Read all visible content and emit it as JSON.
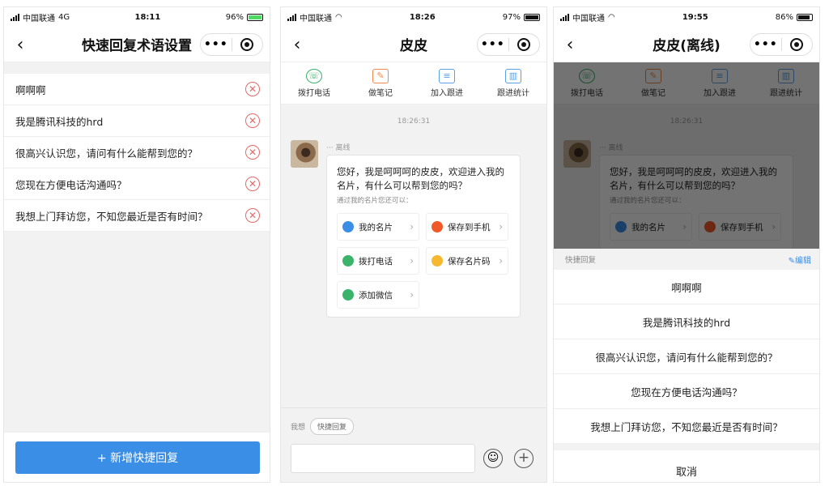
{
  "phone1": {
    "status": {
      "carrier": "中国联通",
      "network": "4G",
      "time": "18:11",
      "battery": "96%"
    },
    "title": "快速回复术语设置",
    "items": [
      {
        "text": "啊啊啊"
      },
      {
        "text": "我是腾讯科技的hrd"
      },
      {
        "text": "很高兴认识您，请问有什么能帮到您的？"
      },
      {
        "text": "您现在方便电话沟通吗？"
      },
      {
        "text": "我想上门拜访您，不知您最近是否有时间？"
      }
    ],
    "add_button": "+ 新增快捷回复"
  },
  "phone2": {
    "status": {
      "carrier": "中国联通",
      "time": "18:26",
      "battery": "97%"
    },
    "title": "皮皮",
    "actions": [
      {
        "label": "拨打电话",
        "icon": "phone-icon",
        "color": "#3bb36b"
      },
      {
        "label": "做笔记",
        "icon": "note-icon",
        "color": "#f08a4b"
      },
      {
        "label": "加入跟进",
        "icon": "follow-icon",
        "color": "#5aa0e6"
      },
      {
        "label": "跟进统计",
        "icon": "stats-icon",
        "color": "#5aa0e6"
      }
    ],
    "timestamp": "18:26:31",
    "sender_status": "··· 离线",
    "message": "您好，我是呵呵呵的皮皮，欢迎进入我的名片，有什么可以帮到您的吗？",
    "sub_hint": "通过我的名片您还可以：",
    "options": [
      {
        "label": "我的名片",
        "color": "#3a8ee6"
      },
      {
        "label": "保存到手机",
        "color": "#f05a28"
      },
      {
        "label": "拨打电话",
        "color": "#3bb36b"
      },
      {
        "label": "保存名片码",
        "color": "#f5b82e"
      },
      {
        "label": "添加微信",
        "color": "#3bb36b"
      }
    ],
    "input_hint": "我想",
    "quick_reply_chip": "快捷回复"
  },
  "phone3": {
    "status": {
      "carrier": "中国联通",
      "time": "19:55",
      "battery": "86%"
    },
    "title": "皮皮(离线)",
    "sheet_header": "快捷回复",
    "edit_label": "编辑",
    "items": [
      {
        "text": "啊啊啊"
      },
      {
        "text": "我是腾讯科技的hrd"
      },
      {
        "text": "很高兴认识您，请问有什么能帮到您的？"
      },
      {
        "text": "您现在方便电话沟通吗？"
      },
      {
        "text": "我想上门拜访您，不知您最近是否有时间？"
      }
    ],
    "cancel_label": "取消"
  }
}
